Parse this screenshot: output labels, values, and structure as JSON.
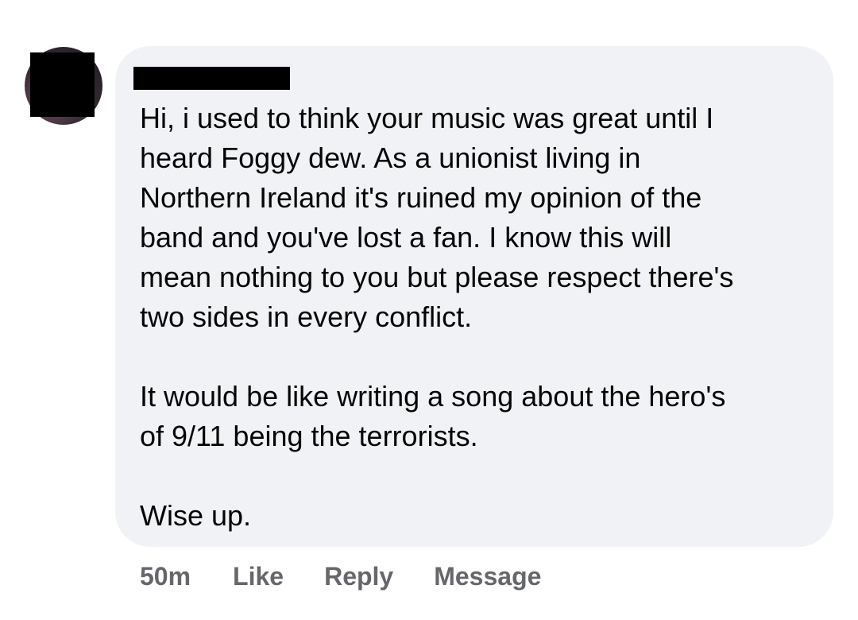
{
  "comment": {
    "paragraphs": [
      {
        "lines": [
          "Hi, i used to think your music was great until I",
          "heard Foggy dew. As a unionist living in",
          "Northern Ireland it's ruined my opinion of the",
          "band and you've lost a fan. I know this will",
          "mean nothing to you but please respect there's",
          "two sides in every conflict."
        ]
      },
      {
        "lines": [
          "It would be like writing a song about the hero's",
          "of 9/11 being the terrorists."
        ]
      },
      {
        "lines": [
          "Wise up."
        ]
      }
    ]
  },
  "actions": {
    "timestamp": "50m",
    "like_label": "Like",
    "reply_label": "Reply",
    "message_label": "Message"
  },
  "colors": {
    "bubble_background": "#f0f2f5",
    "text": "#050505",
    "secondary_text": "#65676b",
    "redaction": "#000000"
  }
}
